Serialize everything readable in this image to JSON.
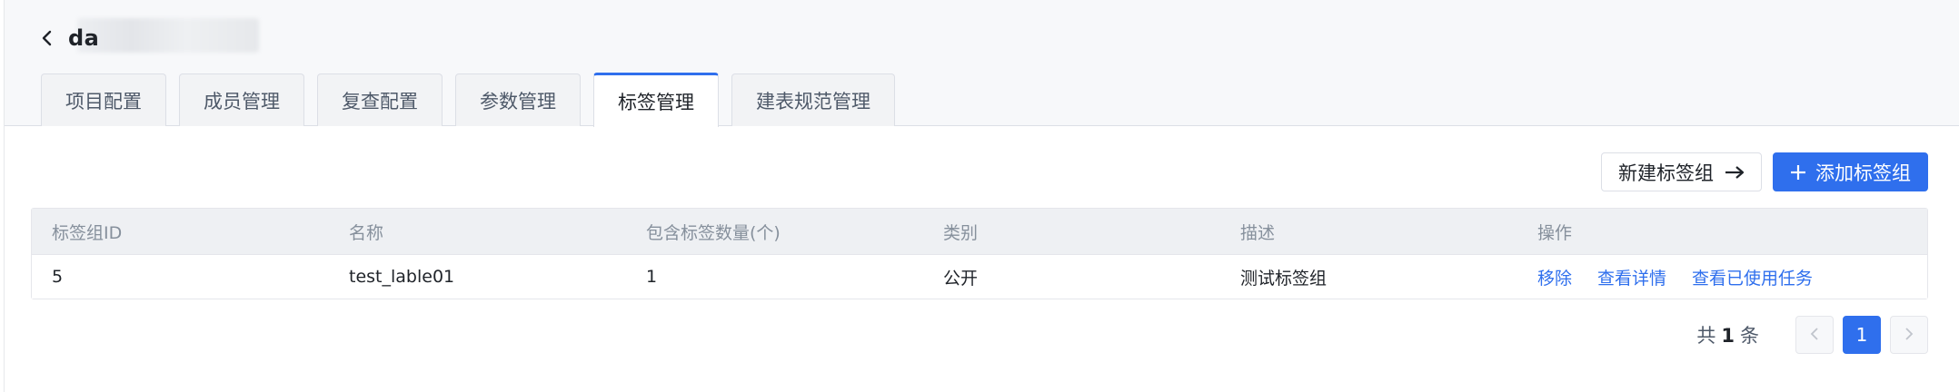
{
  "header": {
    "title": "da",
    "back_icon": "chevron-left-icon"
  },
  "tabs": [
    {
      "label": "项目配置",
      "active": false
    },
    {
      "label": "成员管理",
      "active": false
    },
    {
      "label": "复查配置",
      "active": false
    },
    {
      "label": "参数管理",
      "active": false
    },
    {
      "label": "标签管理",
      "active": true
    },
    {
      "label": "建表规范管理",
      "active": false
    }
  ],
  "toolbar": {
    "new_group_label": "新建标签组",
    "new_group_icon": "arrow-right-icon",
    "add_group_label": "添加标签组",
    "add_group_icon": "plus-icon"
  },
  "table": {
    "columns": [
      "标签组ID",
      "名称",
      "包含标签数量(个)",
      "类别",
      "描述",
      "操作"
    ],
    "rows": [
      {
        "id": "5",
        "name": "test_lable01",
        "count": "1",
        "category": "公开",
        "description": "测试标签组",
        "actions": [
          "移除",
          "查看详情",
          "查看已使用任务"
        ]
      }
    ]
  },
  "pagination": {
    "total_prefix": "共",
    "total": "1",
    "total_suffix": "条",
    "current_page": "1",
    "prev_icon": "chevron-left-icon",
    "next_icon": "chevron-right-icon"
  },
  "colors": {
    "primary": "#2f6fed",
    "header_bg": "#f7f8fa",
    "table_header_bg": "#eef0f3"
  }
}
